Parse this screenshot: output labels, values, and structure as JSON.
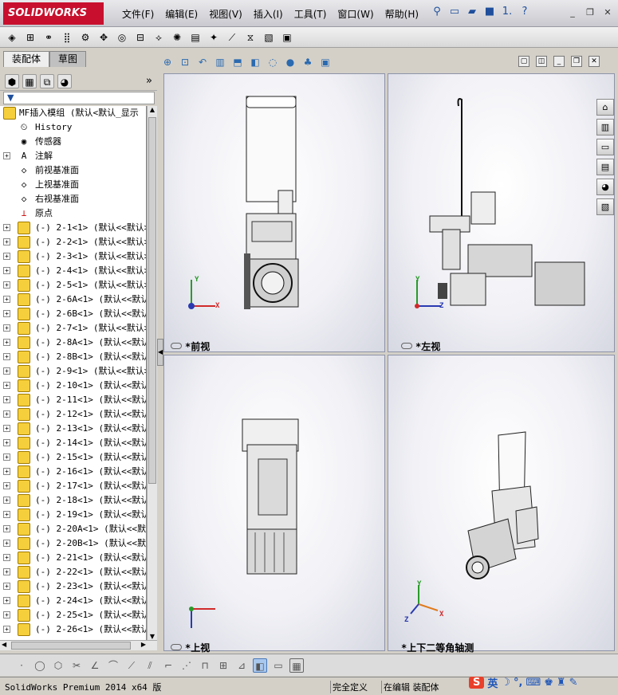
{
  "app": {
    "logo": "SOLIDWORKS"
  },
  "menu": [
    "文件(F)",
    "编辑(E)",
    "视图(V)",
    "插入(I)",
    "工具(T)",
    "窗口(W)",
    "帮助(H)"
  ],
  "title_quick": {
    "page_indicator": "1."
  },
  "tabs": {
    "assembly": "装配体",
    "sketch": "草图"
  },
  "tree": {
    "root": "MF插入模组  (默认<默认_显示",
    "history": "History",
    "sensors": "传感器",
    "annotations": "注解",
    "front_plane": "前视基准面",
    "top_plane": "上视基准面",
    "right_plane": "右视基准面",
    "origin": "原点",
    "parts": [
      "(-) 2-1<1> (默认<<默认>",
      "(-) 2-2<1> (默认<<默认>",
      "(-) 2-3<1> (默认<<默认>",
      "(-) 2-4<1> (默认<<默认>",
      "(-) 2-5<1> (默认<<默认>",
      "(-) 2-6A<1> (默认<<默认",
      "(-) 2-6B<1> (默认<<默认",
      "(-) 2-7<1> (默认<<默认>",
      "(-) 2-8A<1> (默认<<默认",
      "(-) 2-8B<1> (默认<<默认",
      "(-) 2-9<1> (默认<<默认>",
      "(-) 2-10<1> (默认<<默认",
      "(-) 2-11<1> (默认<<默认",
      "(-) 2-12<1> (默认<<默认",
      "(-) 2-13<1> (默认<<默认",
      "(-) 2-14<1> (默认<<默认",
      "(-) 2-15<1> (默认<<默认",
      "(-) 2-16<1> (默认<<默认",
      "(-) 2-17<1> (默认<<默认",
      "(-) 2-18<1> (默认<<默认",
      "(-) 2-19<1> (默认<<默认",
      "(-) 2-20A<1> (默认<<默认",
      "(-) 2-20B<1> (默认<<默认",
      "(-) 2-21<1> (默认<<默认",
      "(-) 2-22<1> (默认<<默认",
      "(-) 2-23<1> (默认<<默认",
      "(-) 2-24<1> (默认<<默认",
      "(-) 2-25<1> (默认<<默认",
      "(-) 2-26<1> (默认<<默认"
    ]
  },
  "viewports": {
    "front": "*前视",
    "left": "*左视",
    "top": "*上视",
    "iso": "*上下二等角轴测"
  },
  "axes": {
    "x": "X",
    "y": "Y",
    "z": "Z"
  },
  "status": {
    "product": "SolidWorks Premium 2014 x64 版",
    "defined": "完全定义",
    "mode": "在编辑 装配体"
  },
  "ime": {
    "lang": "英"
  },
  "colors": {
    "accent": "#c8102e",
    "viewport_border": "#8d93a8"
  }
}
